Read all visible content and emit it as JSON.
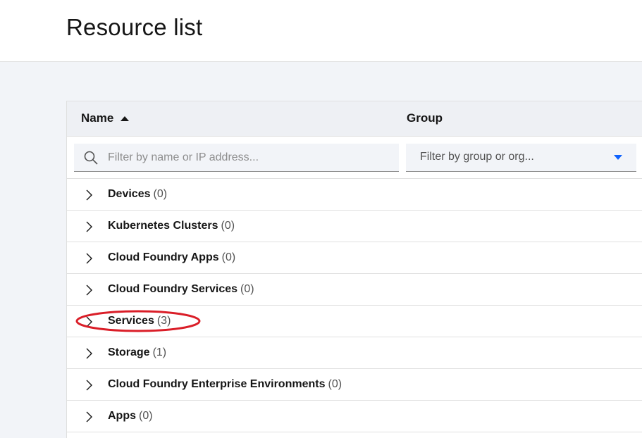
{
  "header": {
    "title": "Resource list"
  },
  "table": {
    "columns": {
      "name": "Name",
      "group": "Group"
    },
    "filters": {
      "search_placeholder": "Filter by name or IP address...",
      "group_placeholder": "Filter by group or org..."
    },
    "rows": [
      {
        "label": "Devices",
        "count": "(0)"
      },
      {
        "label": "Kubernetes Clusters",
        "count": "(0)"
      },
      {
        "label": "Cloud Foundry Apps",
        "count": "(0)"
      },
      {
        "label": "Cloud Foundry Services",
        "count": "(0)"
      },
      {
        "label": "Services",
        "count": "(3)"
      },
      {
        "label": "Storage",
        "count": "(1)"
      },
      {
        "label": "Cloud Foundry Enterprise Environments",
        "count": "(0)"
      },
      {
        "label": "Apps",
        "count": "(0)"
      }
    ]
  },
  "annotation": {
    "color": "#da1e28"
  },
  "icons": {
    "sort": "caret-up-icon",
    "search": "search-icon",
    "dropdown": "caret-down-icon",
    "row_expand": "chevron-right-icon"
  }
}
